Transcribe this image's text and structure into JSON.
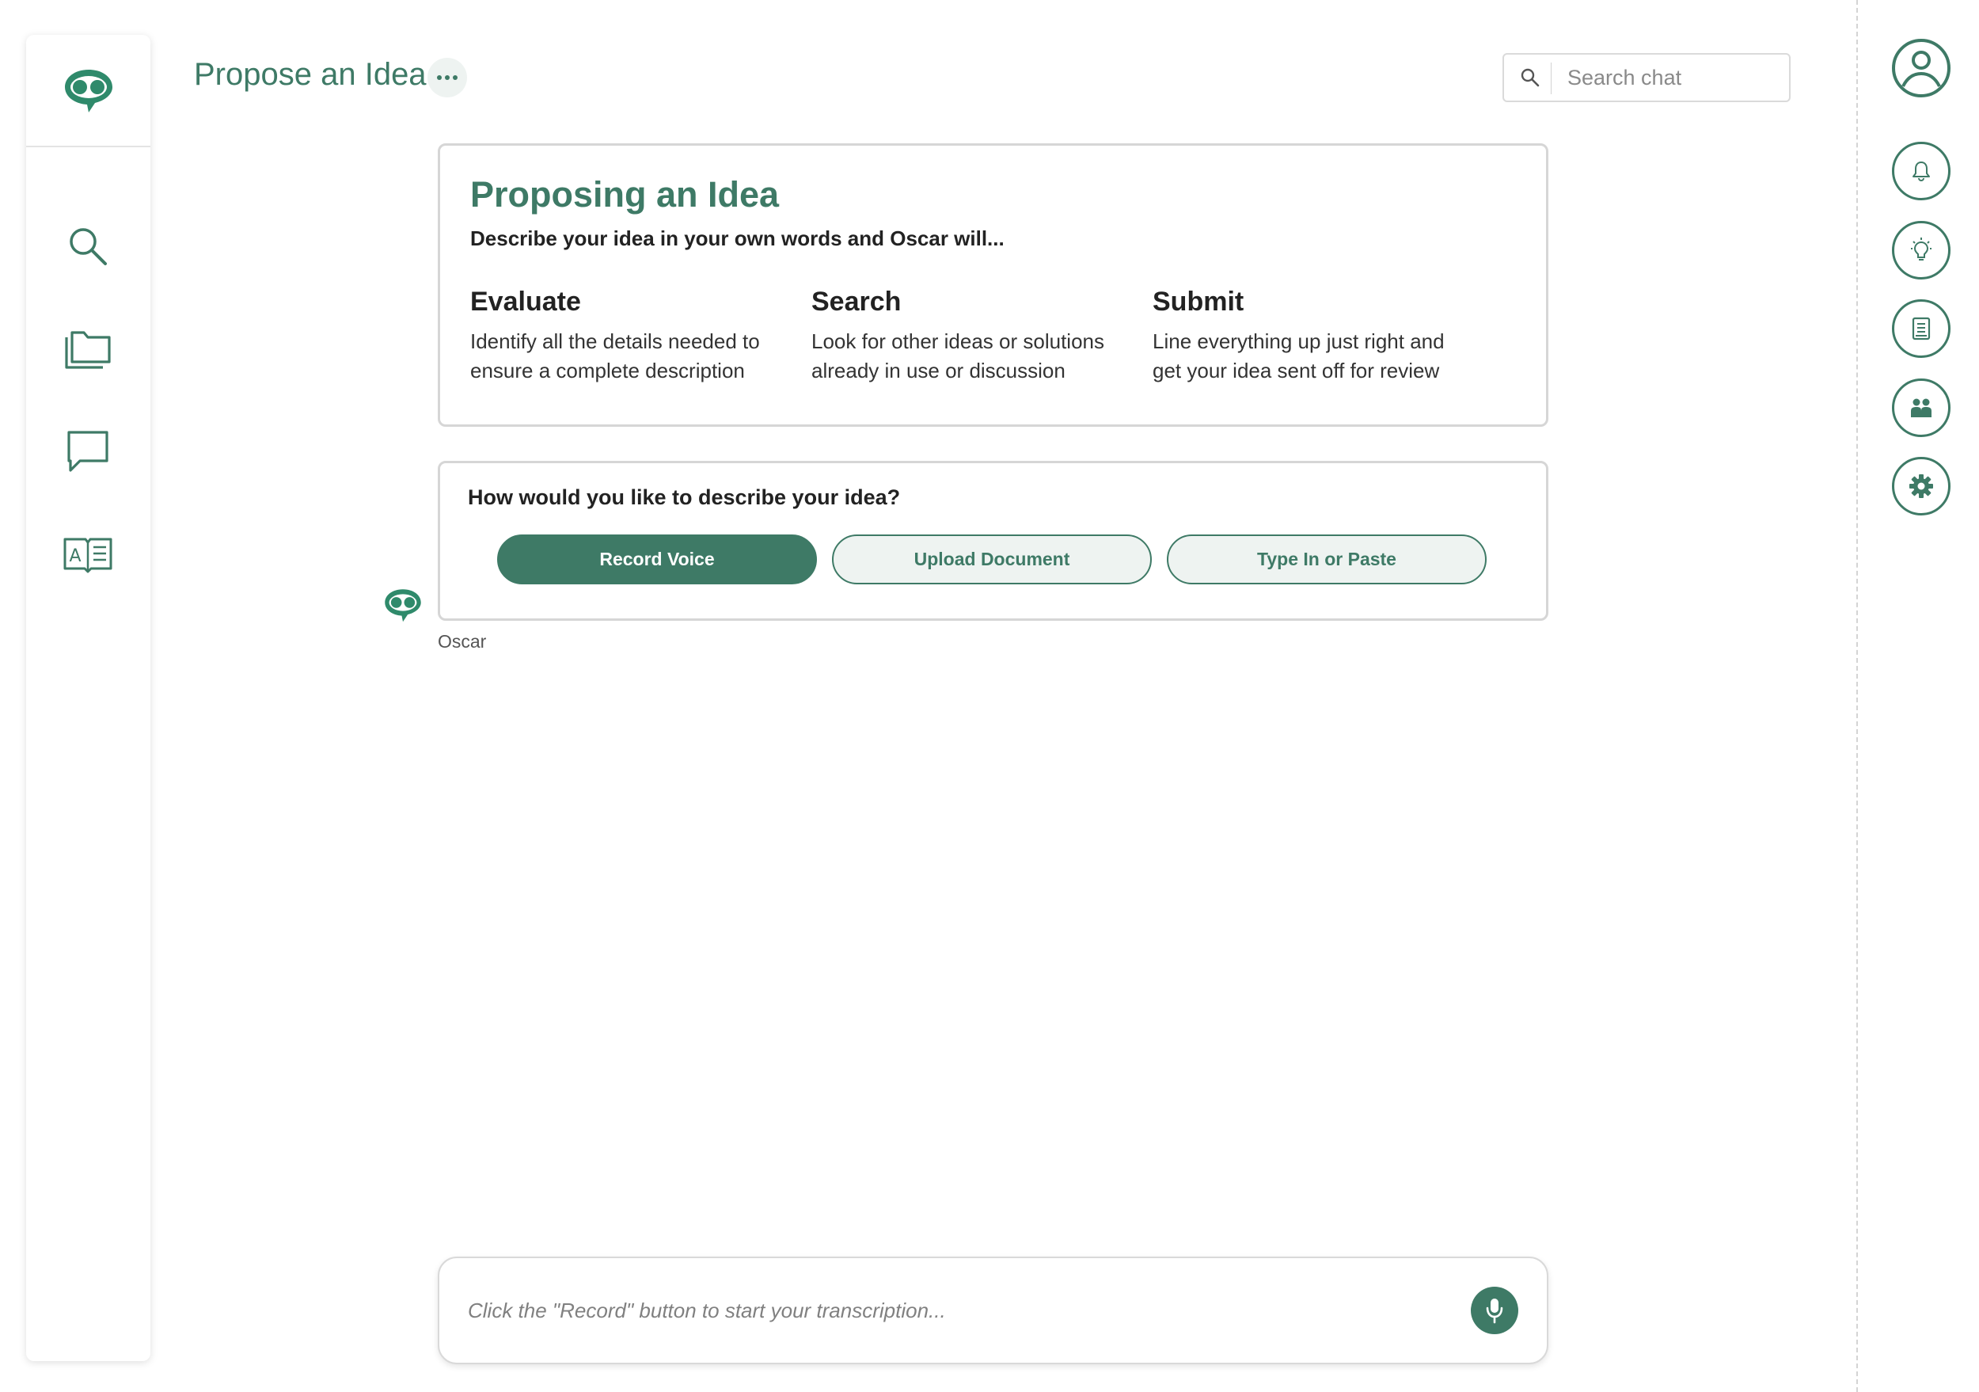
{
  "app": {
    "brand_color": "#3e7a66",
    "brand_tint": "#eef3f1"
  },
  "sidebar": {
    "logo_icon": "oscar-logo-icon",
    "items": [
      {
        "id": "search",
        "icon": "search-icon"
      },
      {
        "id": "files",
        "icon": "folders-icon"
      },
      {
        "id": "chat",
        "icon": "chat-bubble-icon"
      },
      {
        "id": "glossary",
        "icon": "book-icon"
      }
    ]
  },
  "header": {
    "title": "Propose an Idea",
    "more_icon": "more-dots-icon",
    "search": {
      "placeholder": "Search chat",
      "icon": "search-icon"
    }
  },
  "info_card": {
    "title": "Proposing an Idea",
    "subtitle": "Describe your idea in your own words and Oscar will...",
    "steps": [
      {
        "heading": "Evaluate",
        "line1": "Identify all the details needed to",
        "line2": "ensure a complete description"
      },
      {
        "heading": "Search",
        "line1": "Look for other ideas or solutions",
        "line2": "already in use or discussion"
      },
      {
        "heading": "Submit",
        "line1": "Line everything up just right and",
        "line2": "get your idea  sent off for review"
      }
    ]
  },
  "question_card": {
    "question": "How would you like to describe your idea?",
    "options": [
      {
        "label": "Record Voice",
        "selected": true
      },
      {
        "label": "Upload Document",
        "selected": false
      },
      {
        "label": "Type In or Paste",
        "selected": false
      }
    ],
    "sender": "Oscar"
  },
  "composer": {
    "placeholder": "Click the \"Record\" button to start your transcription...",
    "mic_icon": "microphone-icon"
  },
  "right_rail": {
    "items": [
      {
        "id": "profile",
        "icon": "user-avatar-icon"
      },
      {
        "id": "notifications",
        "icon": "bell-icon"
      },
      {
        "id": "ideas",
        "icon": "lightbulb-icon"
      },
      {
        "id": "documents",
        "icon": "document-icon"
      },
      {
        "id": "team",
        "icon": "people-icon"
      },
      {
        "id": "settings",
        "icon": "gear-icon"
      }
    ]
  }
}
